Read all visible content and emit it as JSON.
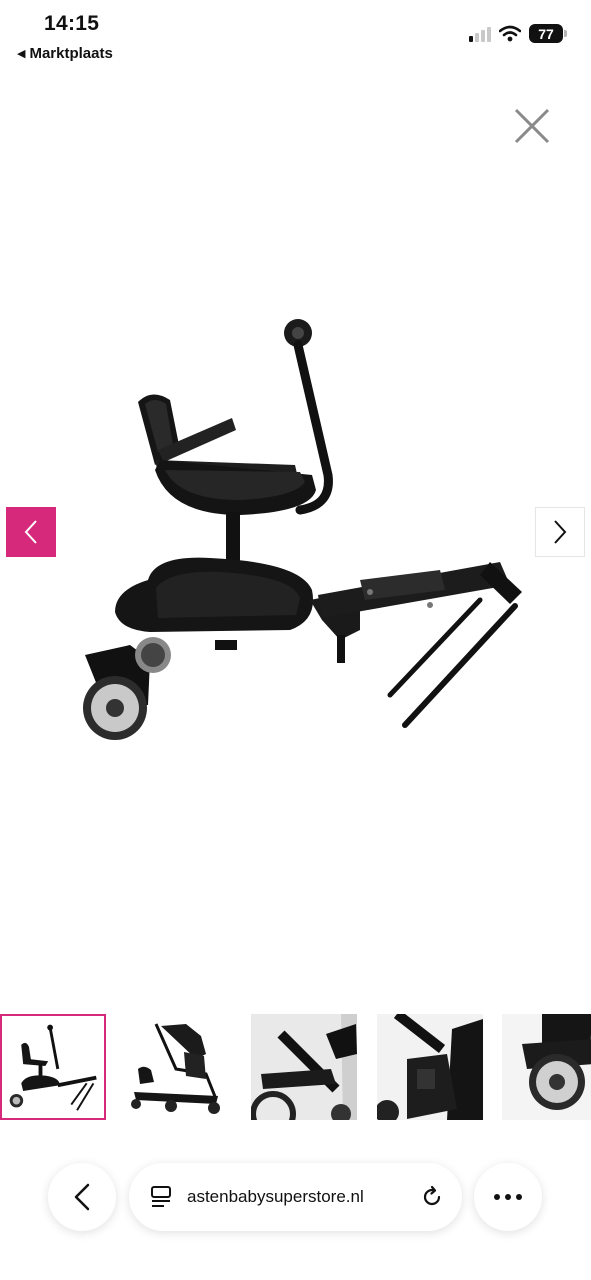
{
  "status_bar": {
    "time": "14:15",
    "back_app": "Marktplaats",
    "battery": "77",
    "icons": [
      "signal-icon",
      "wifi-icon",
      "battery-icon"
    ]
  },
  "viewer": {
    "close_icon": "close-icon",
    "prev_icon": "chevron-left-icon",
    "next_icon": "chevron-right-icon",
    "accent_color": "#d6297c",
    "thumbnail_count": 5,
    "active_thumbnail": 1
  },
  "browser": {
    "back_icon": "chevron-left-icon",
    "reader_icon": "reader-icon",
    "url": "astenbabysuperstore.nl",
    "reload_icon": "reload-icon",
    "more_icon": "more-icon"
  }
}
